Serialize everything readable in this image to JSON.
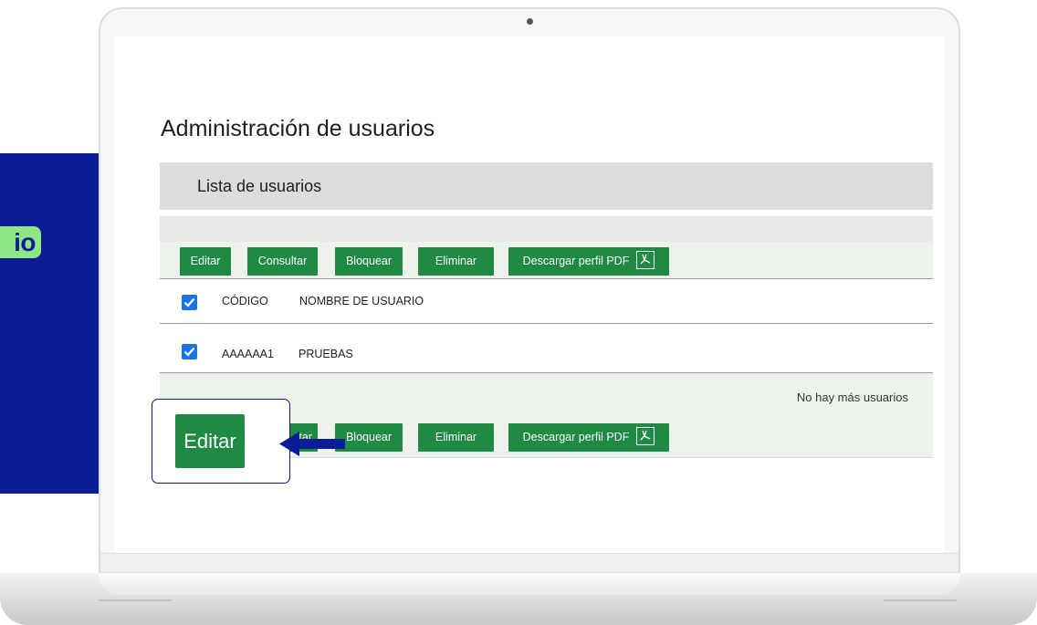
{
  "side_tag": {
    "text": "io"
  },
  "page": {
    "title": "Administración de usuarios"
  },
  "list": {
    "header": "Lista de usuarios"
  },
  "toolbar": {
    "edit": "Editar",
    "consult": "Consultar",
    "block": "Bloquear",
    "delete": "Eliminar",
    "pdf": "Descargar perfil PDF"
  },
  "table": {
    "columns": [
      "CÓDIGO",
      "NOMBRE DE USUARIO"
    ],
    "rows": [
      {
        "code": "AAAAAA1",
        "name": "PRUEBAS",
        "checked": true
      }
    ]
  },
  "status": {
    "no_more": "No hay más usuarios"
  },
  "bottom_toolbar": {
    "consult_partial": "tar",
    "block": "Bloquear",
    "delete": "Eliminar",
    "pdf": "Descargar perfil PDF"
  },
  "callout": {
    "button": "Editar"
  },
  "colors": {
    "primary_green": "#1f8a43",
    "brand_blue": "#0a1d94",
    "accent_green": "#90e584",
    "checkbox_blue": "#1a73e8"
  }
}
